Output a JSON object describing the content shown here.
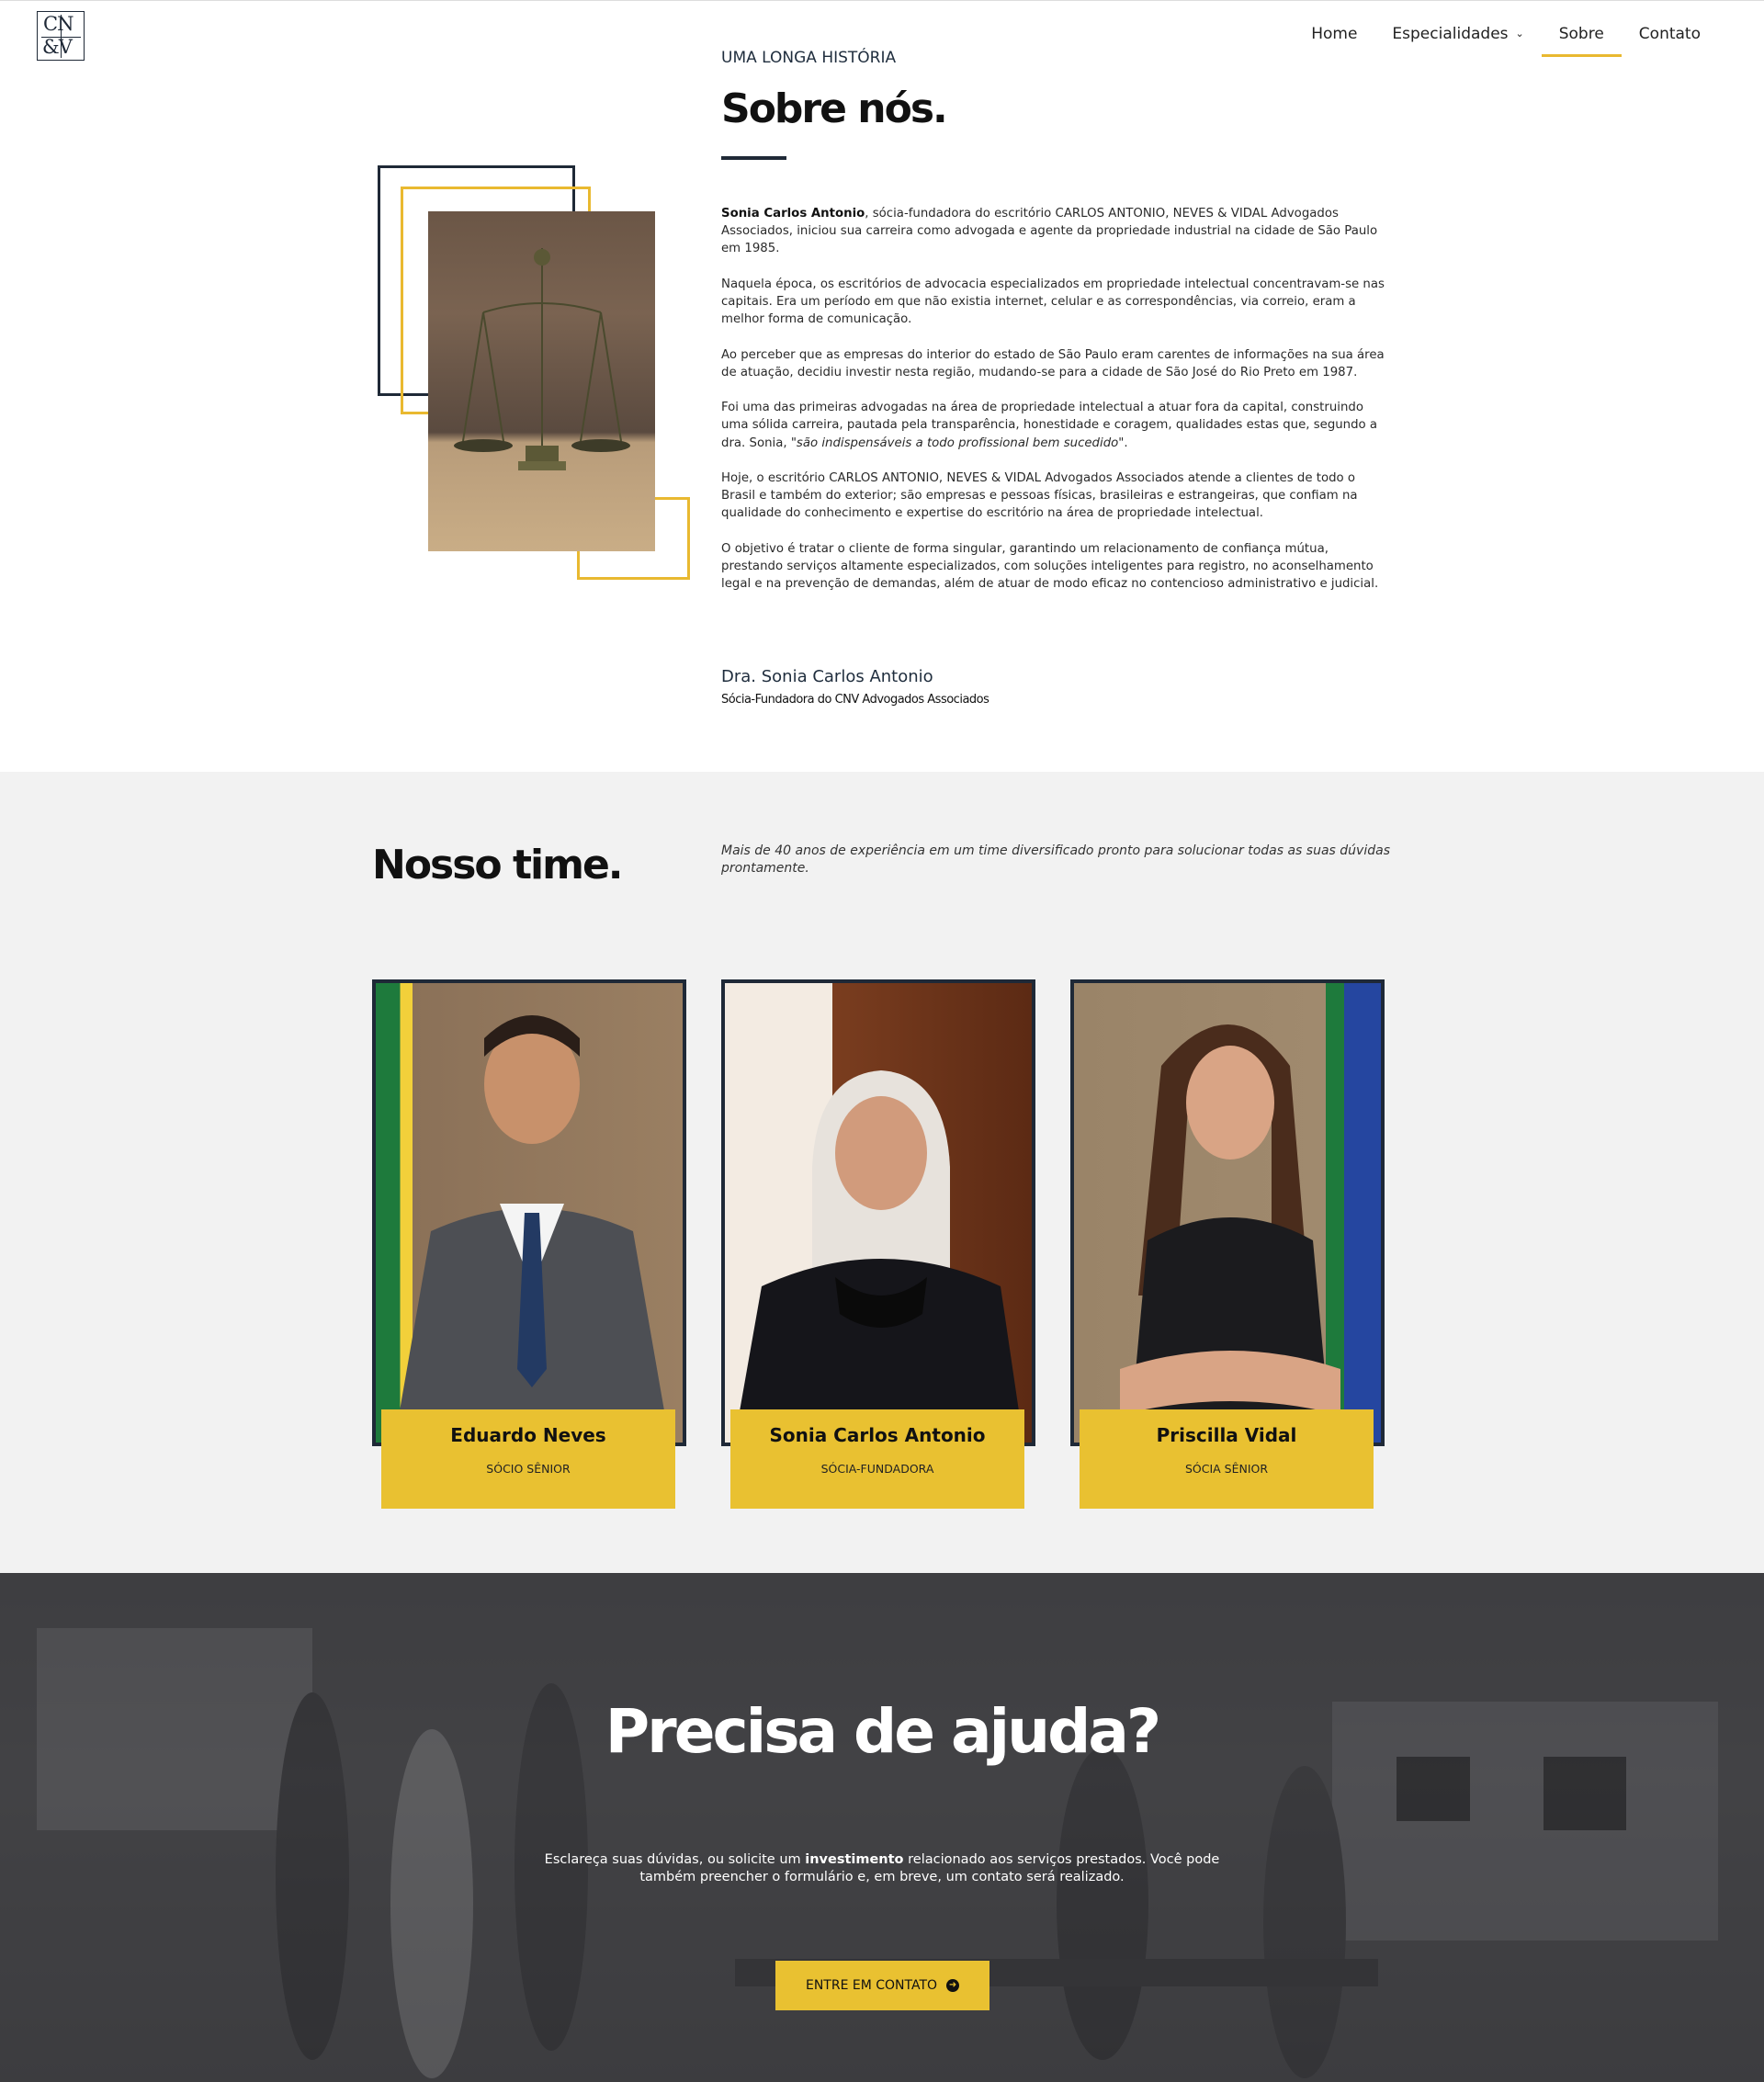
{
  "logo": {
    "line1": "CN",
    "line2": "&V"
  },
  "nav": {
    "items": [
      {
        "label": "Home"
      },
      {
        "label": "Especialidades"
      },
      {
        "label": "Sobre"
      },
      {
        "label": "Contato"
      }
    ]
  },
  "about": {
    "kicker": "UMA LONGA HISTÓRIA",
    "title": "Sobre nós.",
    "p1_bold": "Sonia Carlos Antonio",
    "p1": ", sócia-fundadora do escritório CARLOS ANTONIO, NEVES & VIDAL Advogados Associados, iniciou sua carreira como advogada e agente da propriedade industrial na cidade de São Paulo  em 1985.",
    "p2": "Naquela época, os escritórios de advocacia especializados em propriedade intelectual concentravam-se nas capitais. Era um período em que não existia internet, celular e as correspondências, via correio, eram a melhor forma de comunicação.",
    "p3": "Ao perceber que as empresas do interior do estado de São Paulo eram carentes de informações na sua área de atuação, decidiu investir nesta região, mudando-se para a cidade de São José do Rio Preto em 1987.",
    "p4": "Foi uma das primeiras advogadas na área de propriedade intelectual a atuar fora da capital, construindo uma sólida carreira, pautada pela transparência, honestidade e coragem, qualidades estas que, segundo a dra. Sonia, ",
    "p4_quote": "\"são indispensáveis a todo profissional bem sucedido\"",
    "p4_end": ".",
    "p5": "Hoje, o escritório CARLOS ANTONIO, NEVES & VIDAL Advogados Associados atende a clientes de todo o Brasil e também do exterior; são empresas e pessoas físicas, brasileiras e estrangeiras, que confiam na qualidade do conhecimento e expertise do escritório na área de propriedade intelectual.",
    "p6": "O objetivo é tratar o cliente de forma singular, garantindo um relacionamento de confiança mútua, prestando serviços altamente especializados, com soluções inteligentes para registro, no aconselhamento legal e na prevenção de demandas, além de atuar de modo eficaz no contencioso administrativo e judicial.",
    "signature_name": "Dra. Sonia Carlos Antonio",
    "signature_role": "Sócia-Fundadora do CNV Advogados Associados"
  },
  "team": {
    "title": "Nosso time.",
    "intro": "Mais de 40 anos de experiência em um time diversificado pronto para solucionar todas as suas dúvidas prontamente.",
    "members": [
      {
        "name": "Eduardo Neves",
        "role": "SÓCIO SÊNIOR"
      },
      {
        "name": "Sonia Carlos Antonio",
        "role": "SÓCIA-FUNDADORA"
      },
      {
        "name": "Priscilla Vidal",
        "role": "SÓCIA SÊNIOR"
      }
    ]
  },
  "cta": {
    "title": "Precisa de ajuda?",
    "text_before": "Esclareça suas dúvidas, ou solicite um ",
    "text_bold": "investimento",
    "text_after": " relacionado aos serviços prestados. Você pode também preencher o formulário e, em breve, um contato será realizado.",
    "button_label": "ENTRE EM CONTATO"
  },
  "colors": {
    "accent": "#e9c131",
    "navy": "#1f2937",
    "team_bg": "#f2f2f2"
  }
}
